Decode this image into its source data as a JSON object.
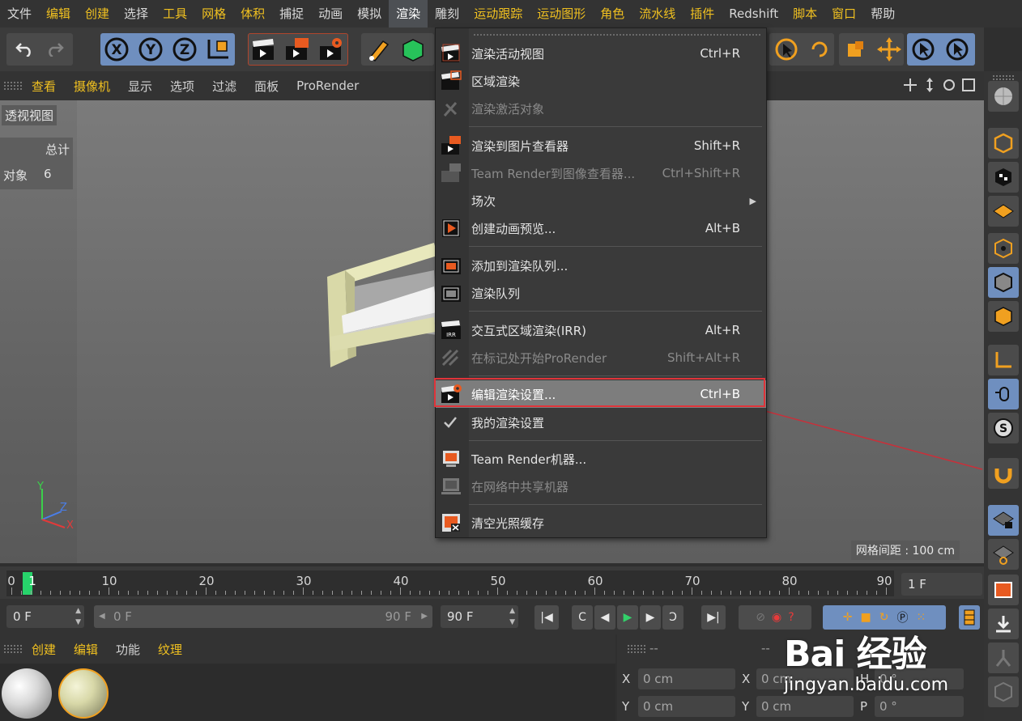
{
  "menubar": {
    "items": [
      "文件",
      "编辑",
      "创建",
      "选择",
      "工具",
      "网格",
      "体积",
      "捕捉",
      "动画",
      "模拟",
      "渲染",
      "雕刻",
      "运动跟踪",
      "运动图形",
      "角色",
      "流水线",
      "插件",
      "Redshift",
      "脚本",
      "窗口",
      "帮助"
    ],
    "active_index": 10
  },
  "viewport": {
    "menu": [
      "查看",
      "摄像机",
      "显示",
      "选项",
      "过滤",
      "面板",
      "ProRender"
    ],
    "title": "透视视图",
    "stats_header": "总计",
    "stats_label": "对象",
    "stats_value": "6",
    "grid_info": "网格间距 : 100 cm",
    "axes": {
      "y": "Y",
      "z": "Z",
      "x": "X"
    }
  },
  "render_menu": {
    "items": [
      {
        "label": "渲染活动视图",
        "shortcut": "Ctrl+R",
        "icon": "clapper-icon",
        "disabled": false
      },
      {
        "label": "区域渲染",
        "shortcut": "",
        "icon": "region-render-icon",
        "disabled": false
      },
      {
        "label": "渲染激活对象",
        "shortcut": "",
        "icon": "render-active-object-icon",
        "disabled": true
      },
      {
        "label": "渲染到图片查看器",
        "shortcut": "Shift+R",
        "icon": "picture-viewer-icon",
        "disabled": false
      },
      {
        "label": "Team Render到图像查看器...",
        "shortcut": "Ctrl+Shift+R",
        "icon": "team-render-viewer-icon",
        "disabled": true
      },
      {
        "label": "场次",
        "shortcut": "",
        "icon": "",
        "disabled": false,
        "submenu": true
      },
      {
        "label": "创建动画预览...",
        "shortcut": "Alt+B",
        "icon": "animation-preview-icon",
        "disabled": false
      },
      {
        "label": "添加到渲染队列...",
        "shortcut": "",
        "icon": "add-render-queue-icon",
        "disabled": false
      },
      {
        "label": "渲染队列",
        "shortcut": "",
        "icon": "render-queue-icon",
        "disabled": false
      },
      {
        "label": "交互式区域渲染(IRR)",
        "shortcut": "Alt+R",
        "icon": "irr-icon",
        "disabled": false
      },
      {
        "label": "在标记处开始ProRender",
        "shortcut": "Shift+Alt+R",
        "icon": "prorender-icon",
        "disabled": true
      },
      {
        "label": "编辑渲染设置...",
        "shortcut": "Ctrl+B",
        "icon": "render-settings-icon",
        "disabled": false,
        "selected": true
      },
      {
        "label": "我的渲染设置",
        "shortcut": "",
        "icon": "checkmark-icon",
        "disabled": false
      },
      {
        "label": "Team Render机器...",
        "shortcut": "",
        "icon": "team-render-machine-icon",
        "disabled": false
      },
      {
        "label": "在网络中共享机器",
        "shortcut": "",
        "icon": "share-machine-icon",
        "disabled": true
      },
      {
        "label": "清空光照缓存",
        "shortcut": "",
        "icon": "clear-cache-icon",
        "disabled": false
      }
    ]
  },
  "timeline": {
    "ticks": [
      "0",
      "10",
      "20",
      "30",
      "40",
      "50",
      "60",
      "70",
      "80",
      "90"
    ],
    "current_marker": "1",
    "frame_field": "1 F"
  },
  "transport": {
    "start": "0 F",
    "range_start": "0 F",
    "range_end": "90 F",
    "end": "90 F"
  },
  "materials": {
    "menu": [
      "创建",
      "编辑",
      "功能",
      "纹理"
    ]
  },
  "coords": {
    "header_left": "--",
    "header_right": "--",
    "x_label": "X",
    "y_label": "Y",
    "x_pos": "0 cm",
    "y_pos": "0 cm",
    "x_size_label": "X",
    "y_size_label": "Y",
    "x_size": "0 cm",
    "y_size": "0 cm",
    "h_label": "H",
    "p_label": "P",
    "h_val": "0 °",
    "p_val": "0 °"
  },
  "watermark": {
    "logo": "Bai 经验",
    "url": "jingyan.baidu.com"
  },
  "colors": {
    "accent_yellow": "#f0c020",
    "highlight_red": "#e0343a",
    "tool_blue": "#6f8fbf",
    "playhead_green": "#27d36b"
  }
}
